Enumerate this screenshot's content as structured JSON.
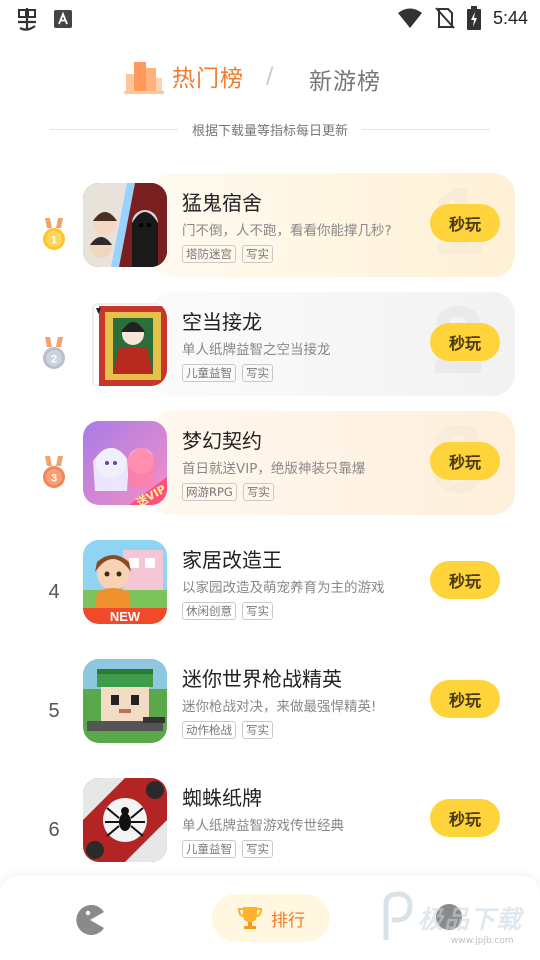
{
  "status_bar": {
    "time": "5:44",
    "left_icons": [
      "bug-app-icon",
      "font-a-icon"
    ],
    "right_icons": [
      "wifi-icon",
      "no-sim-icon",
      "battery-charging-icon"
    ]
  },
  "tabs": {
    "hot": "热门榜",
    "separator": "/",
    "new": "新游榜"
  },
  "subtitle": "根据下载量等指标每日更新",
  "games": [
    {
      "rank": "1",
      "title": "猛鬼宿舍",
      "desc": "门不倒，人不跑，看看你能撑几秒?",
      "tags": [
        "塔防迷宫",
        "写实"
      ],
      "button": "秒玩",
      "badge": "gold",
      "bg_digit": "1"
    },
    {
      "rank": "2",
      "title": "空当接龙",
      "desc": "单人纸牌益智之空当接龙",
      "tags": [
        "儿童益智",
        "写实"
      ],
      "button": "秒玩",
      "badge": "silver",
      "bg_digit": "2"
    },
    {
      "rank": "3",
      "title": "梦幻契约",
      "desc": "首日就送VIP，绝版神装只靠爆",
      "tags": [
        "网游RPG",
        "写实"
      ],
      "button": "秒玩",
      "badge": "bronze",
      "bg_digit": "3",
      "icon_text": "送VIP"
    },
    {
      "rank": "4",
      "title": "家居改造王",
      "desc": "以家园改造及萌宠养育为主的游戏",
      "tags": [
        "休闲创意",
        "写实"
      ],
      "button": "秒玩",
      "icon_text": "NEW"
    },
    {
      "rank": "5",
      "title": "迷你世界枪战精英",
      "desc": "迷你枪战对决，来做最强悍精英!",
      "tags": [
        "动作枪战",
        "写实"
      ],
      "button": "秒玩"
    },
    {
      "rank": "6",
      "title": "蜘蛛纸牌",
      "desc": "单人纸牌益智游戏传世经典",
      "tags": [
        "儿童益智",
        "写实"
      ],
      "button": "秒玩"
    }
  ],
  "bottom_nav": {
    "rank_label": "排行",
    "watermark": "极品下载",
    "watermark_sub": "www.jpjb.com"
  },
  "colors": {
    "accent_orange": "#f07a2d",
    "button_yellow": "#ffd43b",
    "card_gold": "#fff4dc"
  }
}
